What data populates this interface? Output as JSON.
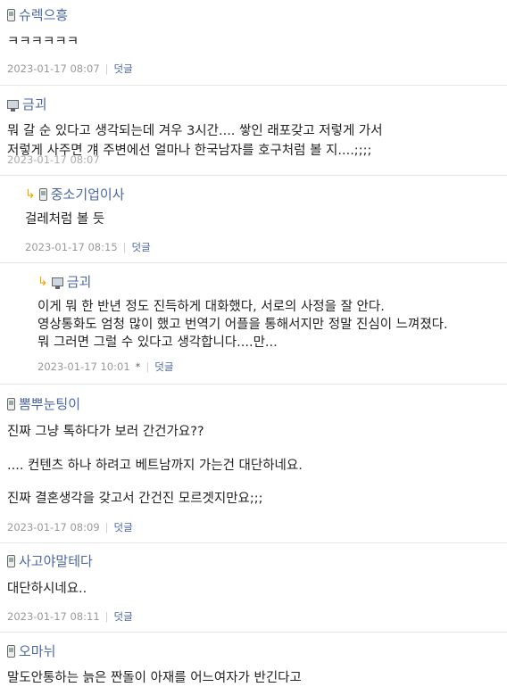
{
  "comments": [
    {
      "author": "슈렉으흥",
      "device": "phone",
      "lines": [
        "ㅋㅋㅋㅋㅋㅋ"
      ],
      "date": "2023-01-17 08:07",
      "reply": "덧글"
    },
    {
      "author": "금괴",
      "device": "pc",
      "lines": [
        "뭐 갈 순 있다고 생각되는데 겨우 3시간.... 쌓인 래포갖고 저렇게 가서",
        "저렇게 사주면 걔 주변에선 얼마나 한국남자를 호구처럼 볼 지....;;;;"
      ],
      "date": "2023-01-17 08:07",
      "reply": "덧글"
    },
    {
      "author": "중소기업이사",
      "device": "phone",
      "lines": [
        "걸레처럼 볼 듯"
      ],
      "date": "2023-01-17 08:15",
      "reply": "덧글"
    },
    {
      "author": "금괴",
      "device": "pc",
      "lines": [
        "이게 뭐 한 반년 정도 진득하게 대화했다, 서로의 사정을 잘 안다.",
        "영상통화도 엄청 많이 했고 번역기 어플을 통해서지만 정말 진심이 느껴졌다.",
        "뭐 그러면 그럴 수 있다고 생각합니다....만..."
      ],
      "date": "2023-01-17 10:01",
      "star": "*",
      "reply": "덧글"
    },
    {
      "author": "뽐뿌눈팅이",
      "device": "phone",
      "lines": [
        "진짜 그냥 톡하다가 보러 간건가요??",
        ".... 컨텐츠 하나 하려고 베트남까지 가는건 대단하네요.",
        "진짜 결혼생각을 갖고서 간건진 모르겟지만요;;;"
      ],
      "date": "2023-01-17 08:09",
      "reply": "덧글"
    },
    {
      "author": "사고야말테다",
      "device": "phone",
      "lines": [
        "대단하시네요.."
      ],
      "date": "2023-01-17 08:11",
      "reply": "덧글"
    },
    {
      "author": "오마뉘",
      "device": "phone",
      "lines": [
        "말도안통하는 늙은 짠돌이 아재를 어느여자가 반긴다고"
      ]
    }
  ]
}
